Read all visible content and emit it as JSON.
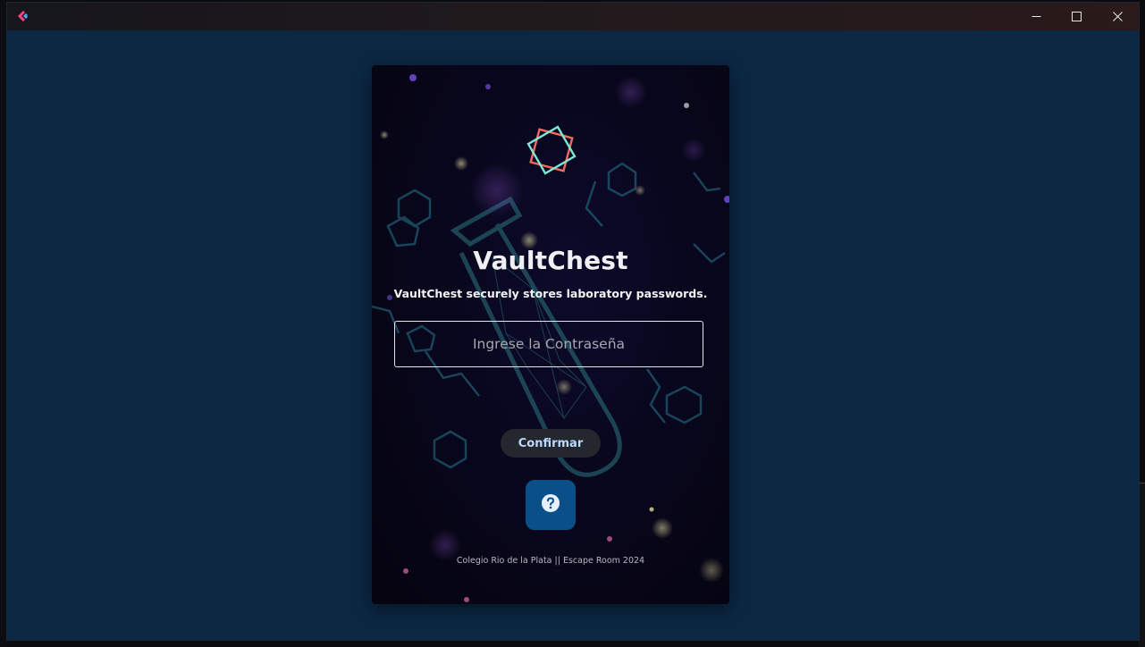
{
  "window": {
    "title": "",
    "controls": {
      "minimize_icon": "minimize-icon",
      "maximize_icon": "maximize-icon",
      "close_icon": "close-icon"
    }
  },
  "login": {
    "title": "VaultChest",
    "subtitle": "VaultChest securely stores laboratory passwords.",
    "password_placeholder": "Ingrese la Contraseña",
    "password_value": "",
    "confirm_label": "Confirmar",
    "help_icon": "question-icon",
    "footer": "Colegio Rio de la Plata || Escape Room 2024"
  },
  "colors": {
    "window_bg": "#0b2742",
    "card_bg": "#08061a",
    "logo_square_outer": "#f06a5e",
    "logo_square_inner": "#7fe6d4",
    "confirm_text": "#b9d9ff",
    "help_button": "#0a4f88"
  }
}
